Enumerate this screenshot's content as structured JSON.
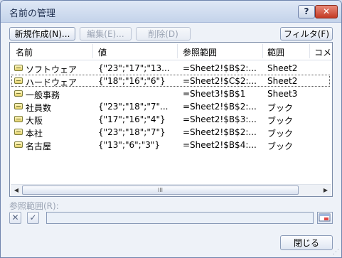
{
  "window": {
    "title": "名前の管理",
    "help": "?",
    "close": "✕"
  },
  "toolbar": {
    "new": "新規作成(N)...",
    "edit": "編集(E)...",
    "delete": "削除(D)",
    "filter": "フィルタ(F) ▾"
  },
  "columns": [
    "名前",
    "値",
    "参照範囲",
    "範囲",
    "コメ"
  ],
  "rows": [
    {
      "name": "ソフトウェア",
      "value": "{\"23\";\"17\";\"13...",
      "ref": "=Sheet2!$B$2:...",
      "scope": "Sheet2"
    },
    {
      "name": "ハードウェア",
      "value": "{\"18\";\"16\";\"6\"}",
      "ref": "=Sheet2!$C$2:...",
      "scope": "Sheet2"
    },
    {
      "name": "一般事務",
      "value": "",
      "ref": "=Sheet3!$B$1",
      "scope": "Sheet3"
    },
    {
      "name": "社員数",
      "value": "{\"23\";\"18\";\"7\"...",
      "ref": "=Sheet2!$B$2:...",
      "scope": "ブック"
    },
    {
      "name": "大阪",
      "value": "{\"17\";\"16\";\"4\"}",
      "ref": "=Sheet2!$B$3:...",
      "scope": "ブック"
    },
    {
      "name": "本社",
      "value": "{\"23\";\"18\";\"7\"}",
      "ref": "=Sheet2!$B$2:...",
      "scope": "ブック"
    },
    {
      "name": "名古屋",
      "value": "{\"13\";\"6\";\"3\"}",
      "ref": "=Sheet2!$B$4:...",
      "scope": "ブック"
    }
  ],
  "scrollbar": {
    "left": "◀",
    "right": "▶",
    "thumb": "III"
  },
  "refers": {
    "label": "参照範囲(R):",
    "value": "",
    "cancel": "✕",
    "ok": "✓"
  },
  "footer": {
    "close_button": "閉じる"
  }
}
